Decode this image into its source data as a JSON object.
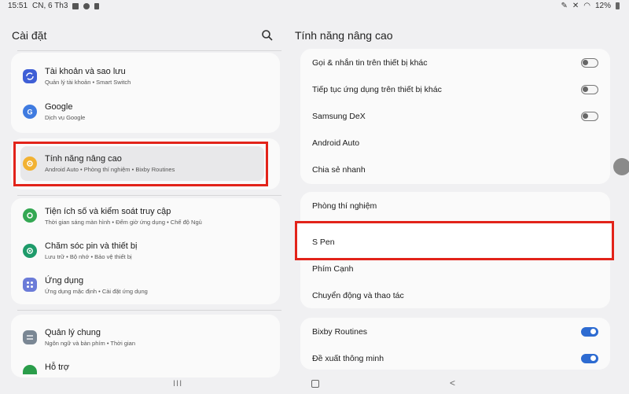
{
  "status": {
    "time": "15:51",
    "date": "CN, 6 Th3",
    "battery": "12%"
  },
  "left": {
    "title": "Cài đặt",
    "items": [
      {
        "title": "Tài khoản và sao lưu",
        "sub": "Quản lý tài khoản  •  Smart Switch",
        "icon": "sync-icon",
        "color": "#3f5fd6"
      },
      {
        "title": "Google",
        "sub": "Dịch vụ Google",
        "icon": "google-icon",
        "color": "#3f7be0"
      },
      {
        "title": "Tính năng nâng cao",
        "sub": "Android Auto  •  Phòng thí nghiệm  •  Bixby Routines",
        "icon": "gear-plus-icon",
        "color": "#f2b233"
      },
      {
        "title": "Tiện ích số và kiểm soát truy cập",
        "sub": "Thời gian sáng màn hình  •  Đếm giờ ứng dụng  •  Chế độ Ngủ",
        "icon": "digital-wellbeing-icon",
        "color": "#34a853"
      },
      {
        "title": "Chăm sóc pin và thiết bị",
        "sub": "Lưu trữ  •  Bộ nhớ  •  Bảo vệ thiết bị",
        "icon": "device-care-icon",
        "color": "#1e9b6a"
      },
      {
        "title": "Ứng dụng",
        "sub": "Ứng dụng mặc định  •  Cài đặt ứng dụng",
        "icon": "apps-icon",
        "color": "#6b7bd8"
      },
      {
        "title": "Quản lý chung",
        "sub": "Ngôn ngữ và bàn phím  •  Thời gian",
        "icon": "sliders-icon",
        "color": "#7a8794"
      },
      {
        "title": "Hỗ trợ",
        "sub": "",
        "icon": "accessibility-icon",
        "color": "#2a9d4a"
      }
    ]
  },
  "right": {
    "title": "Tính năng nâng cao",
    "group1": [
      {
        "label": "Gọi & nhắn tin trên thiết bị khác",
        "toggle": false
      },
      {
        "label": "Tiếp tục ứng dụng trên thiết bị khác",
        "toggle": false
      },
      {
        "label": "Samsung DeX",
        "toggle": false
      },
      {
        "label": "Android Auto"
      },
      {
        "label": "Chia sẻ nhanh"
      }
    ],
    "group2": [
      {
        "label": "Phòng thí nghiệm"
      },
      {
        "label": "S Pen"
      },
      {
        "label": "Phím Cạnh"
      },
      {
        "label": "Chuyển động và thao tác"
      }
    ],
    "group3": [
      {
        "label": "Bixby Routines",
        "toggle": true
      },
      {
        "label": "Đề xuất thông minh",
        "toggle": true
      }
    ]
  },
  "nav": {
    "recents": "III",
    "back": "<"
  }
}
